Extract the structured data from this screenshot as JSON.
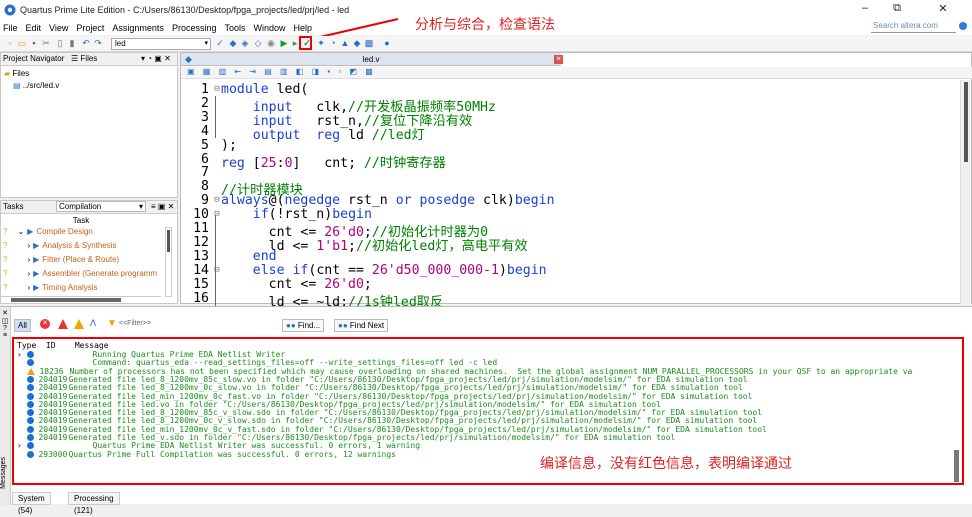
{
  "window": {
    "title": "Quartus Prime Lite Edition - C:/Users/86130/Desktop/fpga_projects/led/prj/led - led",
    "minimize": "–",
    "restore": "⧉",
    "close": "✕"
  },
  "menu": [
    "File",
    "Edit",
    "View",
    "Project",
    "Assignments",
    "Processing",
    "Tools",
    "Window",
    "Help"
  ],
  "search_placeholder": "Search altera.com",
  "toolbar": {
    "entity_select": "led"
  },
  "annotations": {
    "compile": "分析与综合，检查语法",
    "messages": "编译信息，没有红色信息，表明编译通过"
  },
  "project_navigator": {
    "label": "Project Navigator",
    "tab": "Files",
    "root": "Files",
    "file": "../src/led.v"
  },
  "tasks": {
    "label": "Tasks",
    "flow": "Compilation",
    "column": "Task",
    "items": [
      {
        "label": "Compile Design",
        "indent": 0
      },
      {
        "label": "Analysis & Synthesis",
        "indent": 1
      },
      {
        "label": "Fitter (Place & Route)",
        "indent": 1
      },
      {
        "label": "Assembler (Generate programm",
        "indent": 1
      },
      {
        "label": "Timing Analysis",
        "indent": 1
      }
    ]
  },
  "editor": {
    "tab_title": "led.v",
    "lines": [
      {
        "n": "1",
        "g": "⊟",
        "h": "<span class='kw'>module</span> led("
      },
      {
        "n": "2",
        "g": "",
        "h": "    <span class='kw'>input</span>   clk,<span class='cm'>//开发板晶振频率50MHz</span>"
      },
      {
        "n": "3",
        "g": "",
        "h": "    <span class='kw'>input</span>   rst_n,<span class='cm'>//复位下降沿有效</span>"
      },
      {
        "n": "4",
        "g": "",
        "h": "    <span class='kw'>output</span>  <span class='kw'>reg</span> ld <span class='cm'>//led灯</span>"
      },
      {
        "n": "5",
        "g": "",
        "h": ");"
      },
      {
        "n": "6",
        "g": "",
        "h": "<span class='kw'>reg</span> [<span class='nm'>25</span>:<span class='nm'>0</span>]   cnt; <span class='cm'>//时钟寄存器</span>"
      },
      {
        "n": "7",
        "g": "",
        "h": ""
      },
      {
        "n": "8",
        "g": "",
        "h": "<span class='cm'>//计时器模块</span>"
      },
      {
        "n": "9",
        "g": "⊟",
        "h": "<span class='kw'>always</span>@(<span class='kw'>negedge</span> rst_n <span class='kw'>or</span> <span class='kw'>posedge</span> clk)<span class='kw'>begin</span>"
      },
      {
        "n": "10",
        "g": "⊟",
        "h": "    <span class='kw'>if</span>(!rst_n)<span class='kw'>begin</span>"
      },
      {
        "n": "11",
        "g": "",
        "h": "      cnt &lt;= <span class='nm'>26'd0</span>;<span class='cm'>//初始化计时器为0</span>"
      },
      {
        "n": "12",
        "g": "",
        "h": "      ld &lt;= <span class='nm'>1'b1</span>;<span class='cm'>//初始化led灯，高电平有效</span>"
      },
      {
        "n": "13",
        "g": "",
        "h": "    <span class='kw'>end</span>"
      },
      {
        "n": "14",
        "g": "⊟",
        "h": "    <span class='kw'>else</span> <span class='kw'>if</span>(cnt == <span class='nm'>26'd50_000_000-1</span>)<span class='kw'>begin</span>"
      },
      {
        "n": "15",
        "g": "",
        "h": "      cnt &lt;= <span class='nm'>26'd0</span>;"
      },
      {
        "n": "16",
        "g": "",
        "h": "      ld &lt;= ~ld;<span class='cm'>//1s钟led取反</span>"
      }
    ]
  },
  "messages": {
    "filter_all": "All",
    "filter_placeholder": "<<Filter>>",
    "find": "Find...",
    "find_next": "Find Next",
    "headers": {
      "type": "Type",
      "id": "ID",
      "message": "Message"
    },
    "rows": [
      {
        "icon": "info",
        "id": "",
        "text": "Running Quartus Prime EDA Netlist Writer",
        "expand": true
      },
      {
        "icon": "info",
        "id": "",
        "text": "Command: quartus_eda --read_settings_files=off --write_settings_files=off led -c led",
        "expand": false
      },
      {
        "icon": "warn",
        "id": "18236",
        "text": "Number of processors has not been specified which may cause overloading on shared machines.  Set the global assignment NUM_PARALLEL_PROCESSORS in your QSF to an appropriate va",
        "expand": false
      },
      {
        "icon": "info",
        "id": "204019",
        "text": "Generated file led_8_1200mv_85c_slow.vo in folder \"C:/Users/86130/Desktop/fpga_projects/led/prj/simulation/modelsim/\" for EDA simulation tool",
        "expand": false
      },
      {
        "icon": "info",
        "id": "204019",
        "text": "Generated file led_8_1200mv_0c_slow.vo in folder \"C:/Users/86130/Desktop/fpga_projects/led/prj/simulation/modelsim/\" for EDA simulation tool",
        "expand": false
      },
      {
        "icon": "info",
        "id": "204019",
        "text": "Generated file led_min_1200mv_0c_fast.vo in folder \"C:/Users/86130/Desktop/fpga_projects/led/prj/simulation/modelsim/\" for EDA simulation tool",
        "expand": false
      },
      {
        "icon": "info",
        "id": "204019",
        "text": "Generated file led.vo in folder \"C:/Users/86130/Desktop/fpga_projects/led/prj/simulation/modelsim/\" for EDA simulation tool",
        "expand": false
      },
      {
        "icon": "info",
        "id": "204019",
        "text": "Generated file led_8_1200mv_85c_v_slow.sdo in folder \"C:/Users/86130/Desktop/fpga_projects/led/prj/simulation/modelsim/\" for EDA simulation tool",
        "expand": false
      },
      {
        "icon": "info",
        "id": "204019",
        "text": "Generated file led_8_1200mv_0c_v_slow.sdo in folder \"C:/Users/86130/Desktop/fpga_projects/led/prj/simulation/modelsim/\" for EDA simulation tool",
        "expand": false
      },
      {
        "icon": "info",
        "id": "204019",
        "text": "Generated file led_min_1200mv_0c_v_fast.sdo in folder \"C:/Users/86130/Desktop/fpga_projects/led/prj/simulation/modelsim/\" for EDA simulation tool",
        "expand": false
      },
      {
        "icon": "info",
        "id": "204019",
        "text": "Generated file led_v.sdo in folder \"C:/Users/86130/Desktop/fpga_projects/led/prj/simulation/modelsim/\" for EDA simulation tool",
        "expand": false
      },
      {
        "icon": "info",
        "id": "",
        "text": "Quartus Prime EDA Netlist Writer was successful. 0 errors, 1 warning",
        "expand": true
      },
      {
        "icon": "info",
        "id": "293000",
        "text": "Quartus Prime Full Compilation was successful. 0 errors, 12 warnings",
        "expand": false
      }
    ],
    "tabs": [
      "System (54)",
      "Processing (121)"
    ],
    "sidebar_label": "Messages"
  },
  "colors": {
    "keyword": "#1a3fd4",
    "comment": "#008000",
    "number": "#b0007a",
    "annotation": "#e02020",
    "message_text": "#1a8f1a"
  }
}
